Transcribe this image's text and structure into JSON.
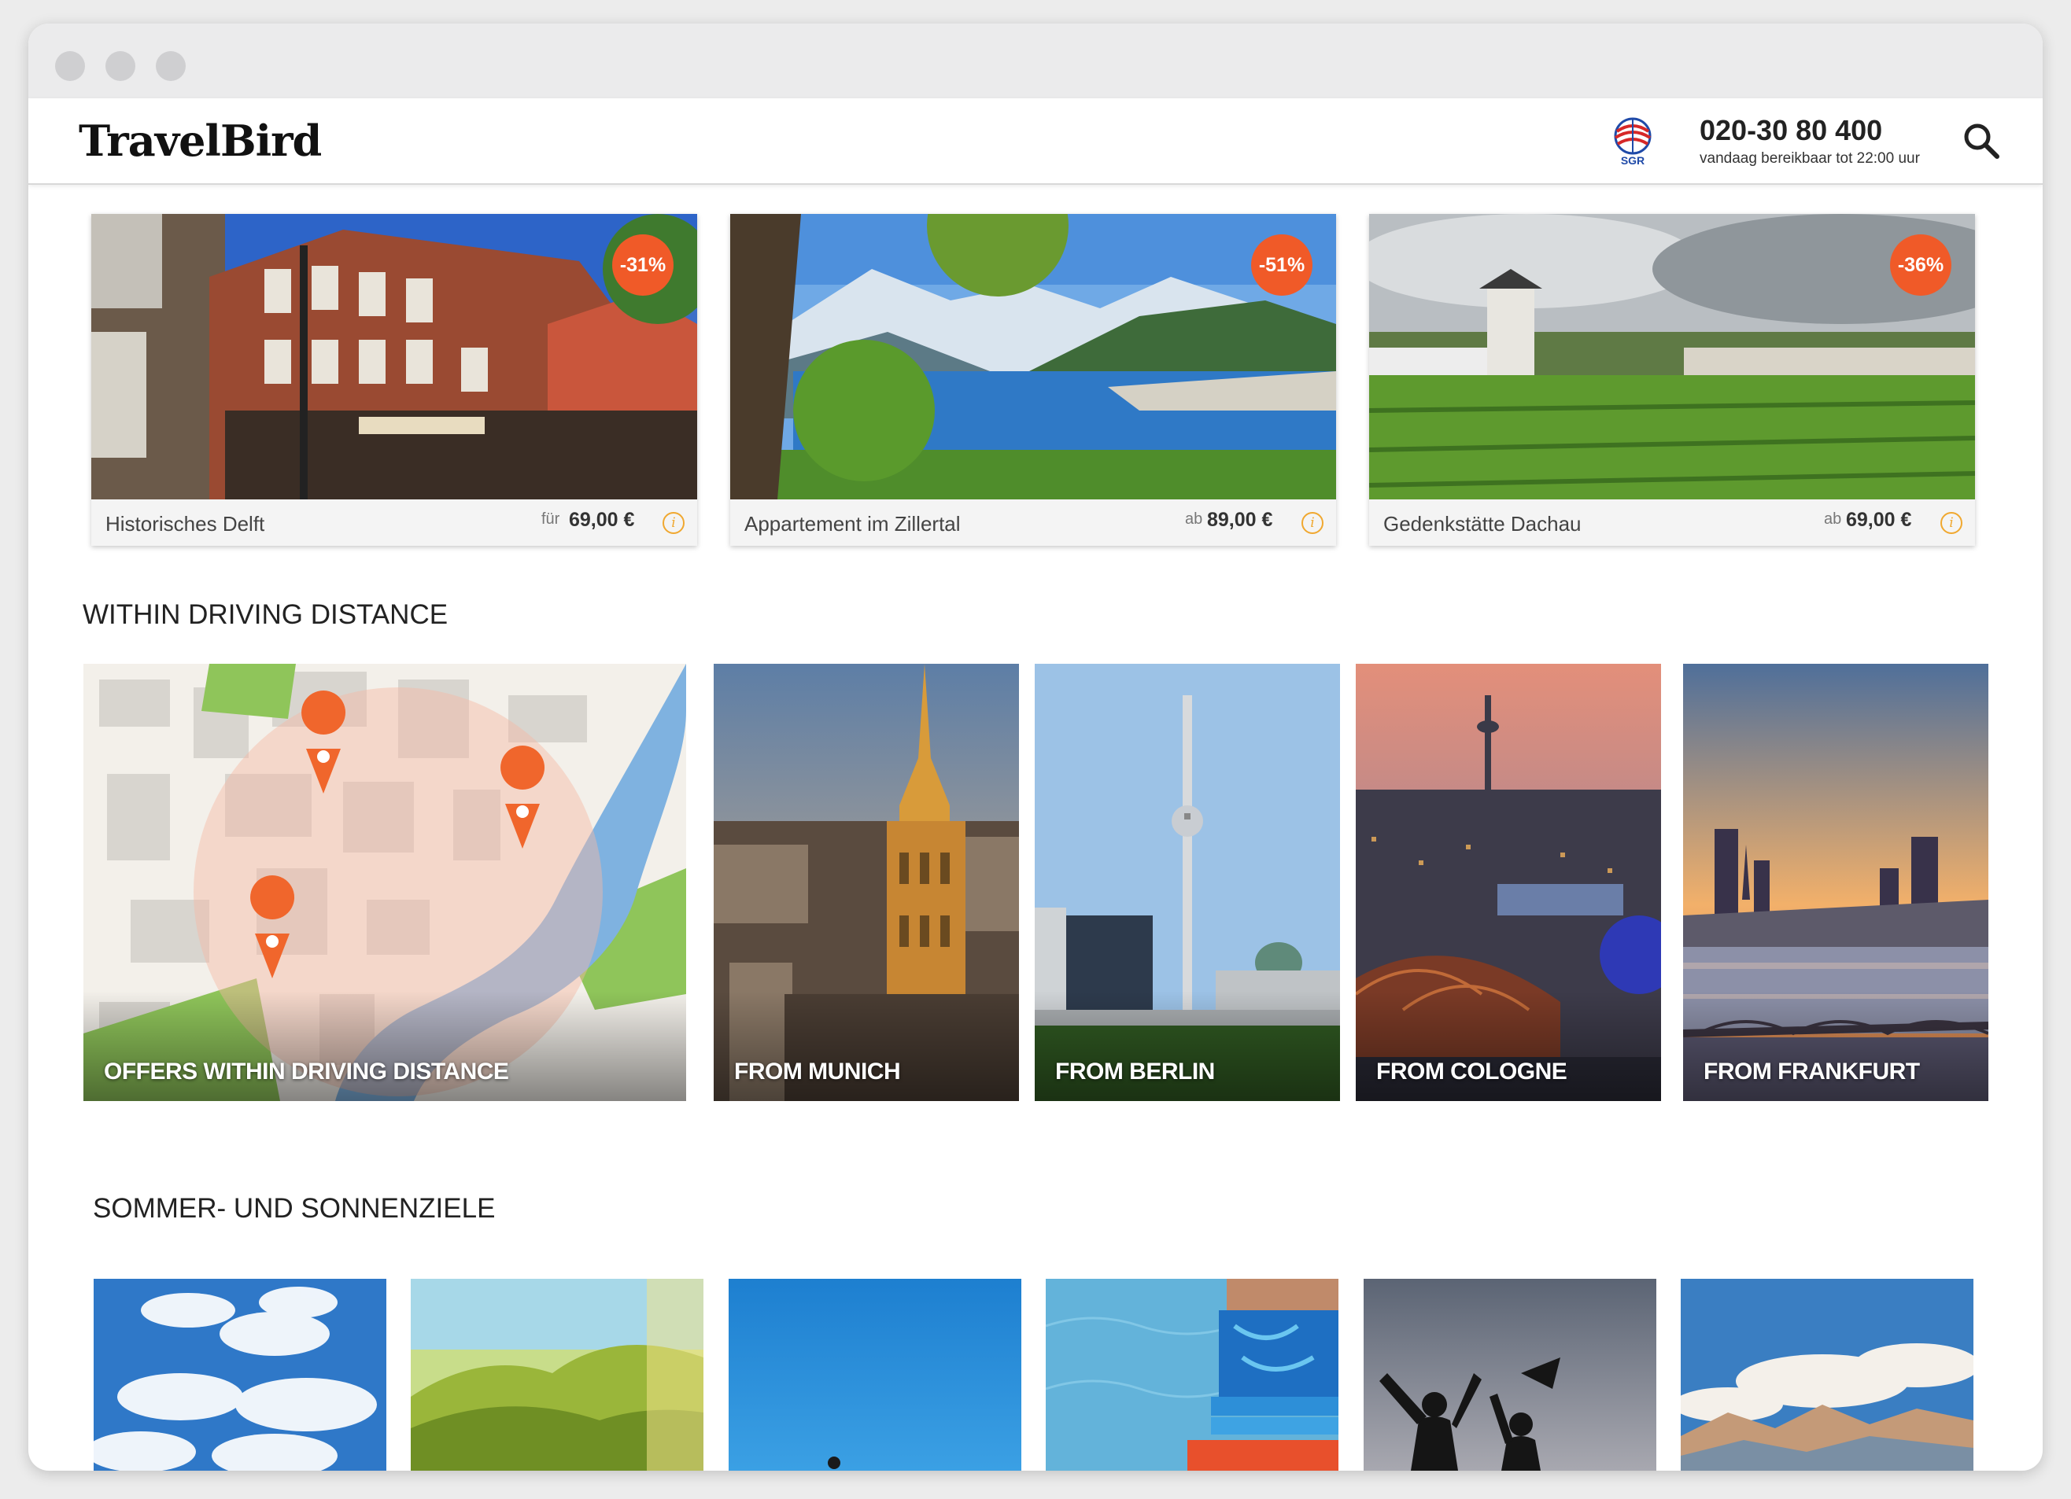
{
  "browser": {
    "controls": [
      "close",
      "minimize",
      "maximize"
    ]
  },
  "header": {
    "logo": "TravelBird",
    "sgr": "SGR",
    "phone": "020-30 80 400",
    "phone_note": "vandaag bereikbaar tot 22:00 uur",
    "search_icon": "search-icon"
  },
  "deals": [
    {
      "title": "Historisches Delft",
      "price_prefix": "für",
      "price": "69,00 €",
      "discount": "-31%"
    },
    {
      "title": "Appartement im Zillertal",
      "price_prefix": "ab",
      "price": "89,00 €",
      "discount": "-51%"
    },
    {
      "title": "Gedenkstätte Dachau",
      "price_prefix": "ab",
      "price": "69,00 €",
      "discount": "-36%"
    }
  ],
  "driving": {
    "heading": "WITHIN DRIVING DISTANCE",
    "tiles": [
      {
        "label": "OFFERS WITHIN DRIVING DISTANCE"
      },
      {
        "label": "FROM MUNICH"
      },
      {
        "label": "FROM BERLIN"
      },
      {
        "label": "FROM COLOGNE"
      },
      {
        "label": "FROM FRANKFURT"
      }
    ]
  },
  "summer": {
    "heading": "SOMMER- UND SONNENZIELE"
  },
  "colors": {
    "accent": "#f05a28",
    "info": "#f0a830",
    "map_water": "#7fb2e0",
    "map_green": "#8fc55a"
  }
}
